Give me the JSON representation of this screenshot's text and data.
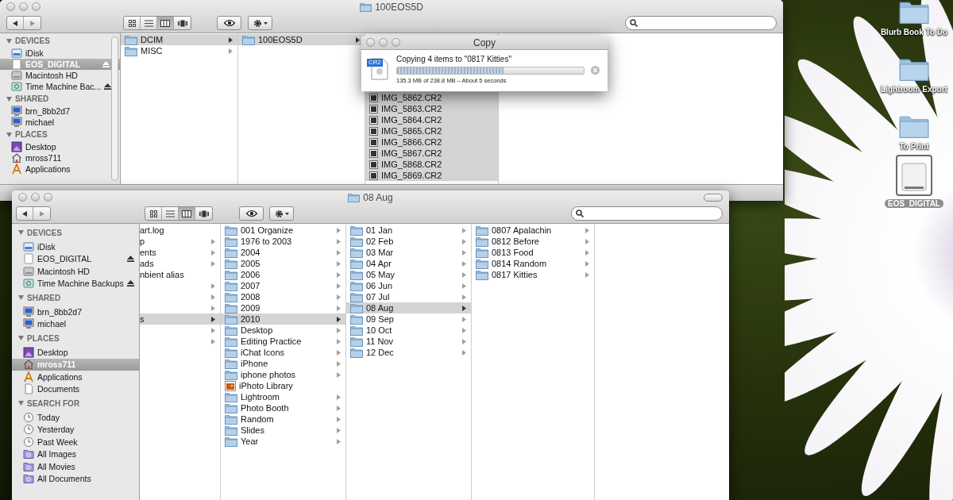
{
  "windows": [
    {
      "title": "100EOS5D",
      "view_buttons": [
        {
          "kind": "icon",
          "selected": false
        },
        {
          "kind": "list",
          "selected": false
        },
        {
          "kind": "column",
          "selected": true
        },
        {
          "kind": "coverflow",
          "selected": false
        }
      ],
      "sidebar": [
        {
          "heading": "DEVICES",
          "items": [
            {
              "label": "iDisk",
              "kind": "idisk",
              "selected": false,
              "eject": false
            },
            {
              "label": "EOS_DIGITAL",
              "kind": "drive",
              "selected": true,
              "eject": true
            },
            {
              "label": "Macintosh HD",
              "kind": "hd",
              "selected": false,
              "eject": false
            },
            {
              "label": "Time Machine Bac...",
              "kind": "backup",
              "selected": false,
              "eject": true
            }
          ]
        },
        {
          "heading": "SHARED",
          "items": [
            {
              "label": "brn_8bb2d7",
              "kind": "computer",
              "selected": false,
              "eject": false
            },
            {
              "label": "michael",
              "kind": "computer",
              "selected": false,
              "eject": false
            }
          ]
        },
        {
          "heading": "PLACES",
          "items": [
            {
              "label": "Desktop",
              "kind": "desktop",
              "selected": false,
              "eject": false
            },
            {
              "label": "mross711",
              "kind": "home",
              "selected": false,
              "eject": false
            },
            {
              "label": "Applications",
              "kind": "apps",
              "selected": false,
              "eject": false
            }
          ]
        }
      ],
      "columns": [
        {
          "items": [
            {
              "label": "DCIM",
              "kind": "folder",
              "selected": true,
              "arrow": true
            },
            {
              "label": "MISC",
              "kind": "folder",
              "selected": false,
              "arrow": true
            }
          ]
        },
        {
          "items": [
            {
              "label": "100EOS5D",
              "kind": "folder",
              "selected": true,
              "arrow": true
            }
          ]
        },
        {
          "items": [
            {
              "label": "IMG_5862.CR2",
              "kind": "image",
              "selected": true,
              "arrow": false
            },
            {
              "label": "IMG_5863.CR2",
              "kind": "image",
              "selected": true,
              "arrow": false
            },
            {
              "label": "IMG_5864.CR2",
              "kind": "image",
              "selected": true,
              "arrow": false
            },
            {
              "label": "IMG_5865.CR2",
              "kind": "image",
              "selected": true,
              "arrow": false
            },
            {
              "label": "IMG_5866.CR2",
              "kind": "image",
              "selected": true,
              "arrow": false
            },
            {
              "label": "IMG_5867.CR2",
              "kind": "image",
              "selected": true,
              "arrow": false
            },
            {
              "label": "IMG_5868.CR2",
              "kind": "image",
              "selected": true,
              "arrow": false
            },
            {
              "label": "IMG_5869.CR2",
              "kind": "image",
              "selected": true,
              "arrow": false
            }
          ]
        }
      ]
    },
    {
      "title": "08 Aug",
      "toolbar_pill": true,
      "view_buttons": [
        {
          "kind": "icon",
          "selected": false
        },
        {
          "kind": "list",
          "selected": false
        },
        {
          "kind": "column",
          "selected": true
        },
        {
          "kind": "coverflow",
          "selected": false
        }
      ],
      "sidebar": [
        {
          "heading": "DEVICES",
          "items": [
            {
              "label": "iDisk",
              "kind": "idisk",
              "selected": false,
              "eject": false
            },
            {
              "label": "EOS_DIGITAL",
              "kind": "drive",
              "selected": false,
              "eject": true
            },
            {
              "label": "Macintosh HD",
              "kind": "hd",
              "selected": false,
              "eject": false
            },
            {
              "label": "Time Machine Backups",
              "kind": "backup",
              "selected": false,
              "eject": true
            }
          ]
        },
        {
          "heading": "SHARED",
          "items": [
            {
              "label": "brn_8bb2d7",
              "kind": "computer",
              "selected": false,
              "eject": false
            },
            {
              "label": "michael",
              "kind": "computer",
              "selected": false,
              "eject": false
            }
          ]
        },
        {
          "heading": "PLACES",
          "items": [
            {
              "label": "Desktop",
              "kind": "desktop",
              "selected": false,
              "eject": false
            },
            {
              "label": "mross711",
              "kind": "home",
              "selected": true,
              "eject": false
            },
            {
              "label": "Applications",
              "kind": "apps",
              "selected": false,
              "eject": false
            },
            {
              "label": "Documents",
              "kind": "docs",
              "selected": false,
              "eject": false
            }
          ]
        },
        {
          "heading": "SEARCH FOR",
          "items": [
            {
              "label": "Today",
              "kind": "clock",
              "selected": false,
              "eject": false
            },
            {
              "label": "Yesterday",
              "kind": "clock",
              "selected": false,
              "eject": false
            },
            {
              "label": "Past Week",
              "kind": "clock",
              "selected": false,
              "eject": false
            },
            {
              "label": "All Images",
              "kind": "smart",
              "selected": false,
              "eject": false
            },
            {
              "label": "All Movies",
              "kind": "smart",
              "selected": false,
              "eject": false
            },
            {
              "label": "All Documents",
              "kind": "smart",
              "selected": false,
              "eject": false
            }
          ]
        }
      ],
      "columns": [
        {
          "items": [
            {
              "label": "art.log",
              "kind": "cut",
              "selected": false,
              "arrow": false
            },
            {
              "label": "p",
              "kind": "cut",
              "selected": false,
              "arrow": true
            },
            {
              "label": "ents",
              "kind": "cut",
              "selected": false,
              "arrow": true
            },
            {
              "label": "ads",
              "kind": "cut",
              "selected": false,
              "arrow": true
            },
            {
              "label": "nbient alias",
              "kind": "cut",
              "selected": false,
              "arrow": false
            },
            {
              "kind": "cut",
              "selected": false,
              "arrow": true
            },
            {
              "kind": "cut",
              "selected": false,
              "arrow": true
            },
            {
              "kind": "cut",
              "selected": false,
              "arrow": true
            },
            {
              "label": "s",
              "kind": "cut",
              "selected": true,
              "arrow": true
            },
            {
              "kind": "cut",
              "selected": false,
              "arrow": true
            },
            {
              "kind": "cut",
              "selected": false,
              "arrow": true
            }
          ]
        },
        {
          "items": [
            {
              "label": "001 Organize",
              "kind": "folder",
              "selected": false,
              "arrow": true
            },
            {
              "label": "1976 to 2003",
              "kind": "folder",
              "selected": false,
              "arrow": true
            },
            {
              "label": "2004",
              "kind": "folder",
              "selected": false,
              "arrow": true
            },
            {
              "label": "2005",
              "kind": "folder",
              "selected": false,
              "arrow": true
            },
            {
              "label": "2006",
              "kind": "folder",
              "selected": false,
              "arrow": true
            },
            {
              "label": "2007",
              "kind": "folder",
              "selected": false,
              "arrow": true
            },
            {
              "label": "2008",
              "kind": "folder",
              "selected": false,
              "arrow": true
            },
            {
              "label": "2009",
              "kind": "folder",
              "selected": false,
              "arrow": true
            },
            {
              "label": "2010",
              "kind": "folder",
              "selected": true,
              "arrow": true
            },
            {
              "label": "Desktop",
              "kind": "folder",
              "selected": false,
              "arrow": true
            },
            {
              "label": "Editing Practice",
              "kind": "folder",
              "selected": false,
              "arrow": true
            },
            {
              "label": "iChat Icons",
              "kind": "folder",
              "selected": false,
              "arrow": true
            },
            {
              "label": "iPhone",
              "kind": "folder",
              "selected": false,
              "arrow": true
            },
            {
              "label": "iphone photos",
              "kind": "folder",
              "selected": false,
              "arrow": true
            },
            {
              "label": "iPhoto Library",
              "kind": "library",
              "selected": false,
              "arrow": false
            },
            {
              "label": "Lightroom",
              "kind": "folder",
              "selected": false,
              "arrow": true
            },
            {
              "label": "Photo Booth",
              "kind": "folder",
              "selected": false,
              "arrow": true
            },
            {
              "label": "Random",
              "kind": "folder",
              "selected": false,
              "arrow": true
            },
            {
              "label": "Slides",
              "kind": "folder",
              "selected": false,
              "arrow": true
            },
            {
              "label": "Year",
              "kind": "folder",
              "selected": false,
              "arrow": true
            }
          ]
        },
        {
          "items": [
            {
              "label": "01 Jan",
              "kind": "folder",
              "selected": false,
              "arrow": true
            },
            {
              "label": "02 Feb",
              "kind": "folder",
              "selected": false,
              "arrow": true
            },
            {
              "label": "03 Mar",
              "kind": "folder",
              "selected": false,
              "arrow": true
            },
            {
              "label": "04 Apr",
              "kind": "folder",
              "selected": false,
              "arrow": true
            },
            {
              "label": "05 May",
              "kind": "folder",
              "selected": false,
              "arrow": true
            },
            {
              "label": "06 Jun",
              "kind": "folder",
              "selected": false,
              "arrow": true
            },
            {
              "label": "07 Jul",
              "kind": "folder",
              "selected": false,
              "arrow": true
            },
            {
              "label": "08 Aug",
              "kind": "folder",
              "selected": true,
              "arrow": true
            },
            {
              "label": "09 Sep",
              "kind": "folder",
              "selected": false,
              "arrow": true
            },
            {
              "label": "10 Oct",
              "kind": "folder",
              "selected": false,
              "arrow": true
            },
            {
              "label": "11 Nov",
              "kind": "folder",
              "selected": false,
              "arrow": true
            },
            {
              "label": "12 Dec",
              "kind": "folder",
              "selected": false,
              "arrow": true
            }
          ]
        },
        {
          "items": [
            {
              "label": "0807 Apalachin",
              "kind": "folder",
              "selected": false,
              "arrow": true
            },
            {
              "label": "0812 Before",
              "kind": "folder",
              "selected": false,
              "arrow": true
            },
            {
              "label": "0813 Food",
              "kind": "folder",
              "selected": false,
              "arrow": true
            },
            {
              "label": "0814 Random",
              "kind": "folder",
              "selected": false,
              "arrow": true
            },
            {
              "label": "0817 Kitties",
              "kind": "folder",
              "selected": false,
              "arrow": true
            }
          ]
        }
      ]
    }
  ],
  "copy_dialog": {
    "title": "Copy",
    "file_badge": "CR2",
    "message": "Copying 4 items to \"0817 Kitties\"",
    "level": 0.57,
    "status": "135.3 MB of 238.8 MB – About 5 seconds"
  },
  "desktop_icons": [
    {
      "label": "Blurb Book To Do",
      "kind": "folder",
      "selected": false
    },
    {
      "label": "Lightroom Export",
      "kind": "folder",
      "selected": false
    },
    {
      "label": "To Print",
      "kind": "folder",
      "selected": false
    },
    {
      "label": "EOS_DIGITAL",
      "kind": "drive",
      "selected": true
    }
  ]
}
